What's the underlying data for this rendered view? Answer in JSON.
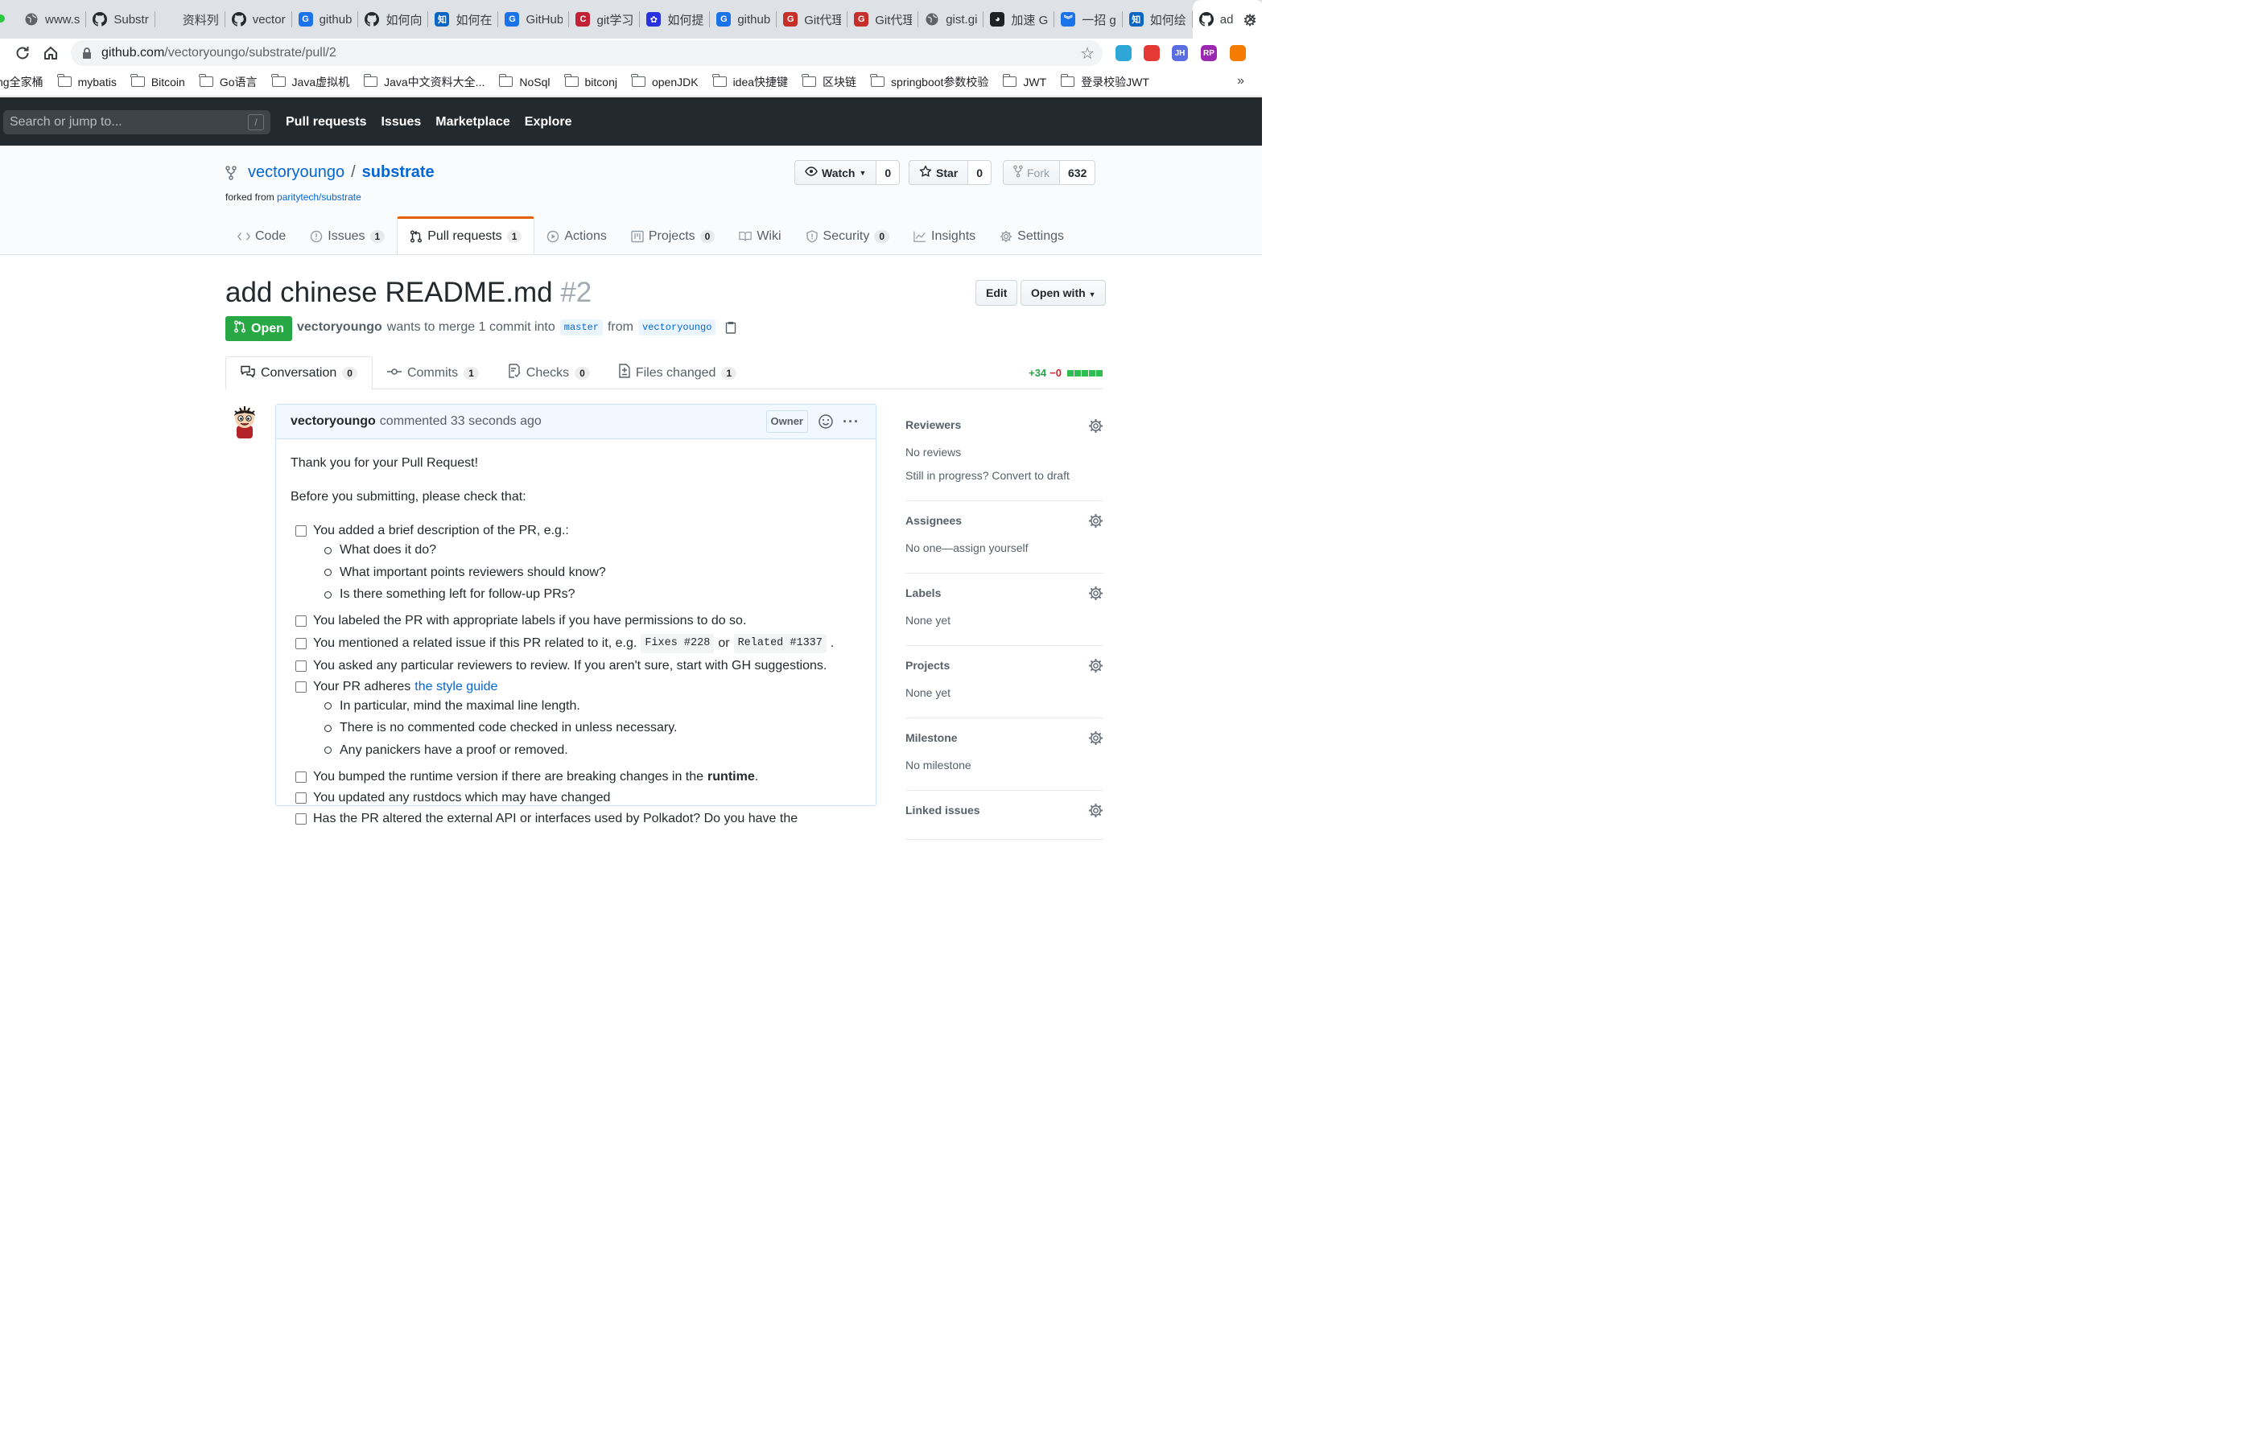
{
  "browser": {
    "tabs": [
      {
        "title": "www.s",
        "favicon": "globe-icon",
        "color": "#5f6368"
      },
      {
        "title": "Substr",
        "favicon": "github-icon",
        "color": "#24292e"
      },
      {
        "title": "资料列",
        "favicon": "blank-icon",
        "color": "#dee1e6"
      },
      {
        "title": "vector",
        "favicon": "github-icon",
        "color": "#24292e"
      },
      {
        "title": "github",
        "favicon": "letter-g-icon",
        "color": "#1a73e8"
      },
      {
        "title": "如何向",
        "favicon": "github-icon",
        "color": "#24292e"
      },
      {
        "title": "如何在",
        "favicon": "zhihu-icon",
        "color": "#0a66c2"
      },
      {
        "title": "GitHub",
        "favicon": "letter-g-icon",
        "color": "#1a73e8"
      },
      {
        "title": "git学习",
        "favicon": "csdn-icon",
        "color": "#c32136"
      },
      {
        "title": "如何提",
        "favicon": "baidu-icon",
        "color": "#2932e1"
      },
      {
        "title": "github",
        "favicon": "letter-g-icon",
        "color": "#1a73e8"
      },
      {
        "title": "Git代理",
        "favicon": "letter-g-red-icon",
        "color": "#c7302a"
      },
      {
        "title": "Git代理",
        "favicon": "letter-g-red-icon",
        "color": "#c7302a"
      },
      {
        "title": "gist.gi",
        "favicon": "globe-icon",
        "color": "#5f6368"
      },
      {
        "title": "加速 G",
        "favicon": "cat-icon",
        "color": "#202124"
      },
      {
        "title": "一招 g",
        "favicon": "chevrons-icon",
        "color": "#1a73e8"
      },
      {
        "title": "如何绘",
        "favicon": "zhihu-icon",
        "color": "#0a66c2"
      }
    ],
    "active_tab": {
      "title": "ad",
      "favicon": "github-icon"
    },
    "url_host": "github.com",
    "url_path": "/vectoryoungo/substrate/pull/2",
    "bookmarks": [
      "ng全家桶",
      "mybatis",
      "Bitcoin",
      "Go语言",
      "Java虚拟机",
      "Java中文资料大全...",
      "NoSql",
      "bitconj",
      "openJDK",
      "idea快捷键",
      "区块链",
      "springboot参数校验",
      "JWT",
      "登录校验JWT"
    ],
    "bookmarks_more": "»",
    "extensions": [
      {
        "name": "shield-ext-icon",
        "label": "",
        "color": "#2ea6d6"
      },
      {
        "name": "red-ext-icon",
        "label": "",
        "color": "#e53935"
      },
      {
        "name": "jh-ext-icon",
        "label": "JH",
        "color": "#5b6ee1"
      },
      {
        "name": "rp-ext-icon",
        "label": "RP",
        "color": "#9c27b0"
      },
      {
        "name": "orange-ext-icon",
        "label": "",
        "color": "#f57c00"
      }
    ]
  },
  "gh_header": {
    "search_placeholder": "Search or jump to...",
    "search_key": "/",
    "nav": [
      "Pull requests",
      "Issues",
      "Marketplace",
      "Explore"
    ]
  },
  "repo": {
    "owner": "vectoryoungo",
    "name": "substrate",
    "forked_label": "forked from",
    "forked_from": "paritytech/substrate",
    "watch_label": "Watch",
    "watch_count": "0",
    "star_label": "Star",
    "star_count": "0",
    "fork_label": "Fork",
    "fork_count": "632",
    "tabs": [
      {
        "label": "Code",
        "count": ""
      },
      {
        "label": "Issues",
        "count": "1"
      },
      {
        "label": "Pull requests",
        "count": "1"
      },
      {
        "label": "Actions",
        "count": ""
      },
      {
        "label": "Projects",
        "count": "0"
      },
      {
        "label": "Wiki",
        "count": ""
      },
      {
        "label": "Security",
        "count": "0"
      },
      {
        "label": "Insights",
        "count": ""
      },
      {
        "label": "Settings",
        "count": ""
      }
    ]
  },
  "pr": {
    "title": "add chinese README.md",
    "number": "#2",
    "edit_label": "Edit",
    "open_with_label": "Open with",
    "state": "Open",
    "author": "vectoryoungo",
    "meta_text": "wants to merge 1 commit into",
    "base_branch": "master",
    "from_text": "from",
    "head_branch": "vectoryoungo",
    "tabs": [
      {
        "label": "Conversation",
        "count": "0"
      },
      {
        "label": "Commits",
        "count": "1"
      },
      {
        "label": "Checks",
        "count": "0"
      },
      {
        "label": "Files changed",
        "count": "1"
      }
    ],
    "additions": "+34",
    "deletions": "−0"
  },
  "comment": {
    "author": "vectoryoungo",
    "time_text": "commented 33 seconds ago",
    "owner_badge": "Owner",
    "more": "···",
    "para1": "Thank you for your Pull Request!",
    "para2": "Before you submitting, please check that:",
    "item1": "You added a brief description of the PR, e.g.:",
    "item1_sub": [
      "What does it do?",
      "What important points reviewers should know?",
      "Is there something left for follow-up PRs?"
    ],
    "item2": "You labeled the PR with appropriate labels if you have permissions to do so.",
    "item3_pre": "You mentioned a related issue if this PR related to it, e.g.",
    "item3_code1": "Fixes #228",
    "item3_or": "or",
    "item3_code2": "Related #1337",
    "item3_post": ".",
    "item4": "You asked any particular reviewers to review. If you aren't sure, start with GH suggestions.",
    "item5_pre": "Your PR adheres",
    "item5_link": "the style guide",
    "item5_sub": [
      "In particular, mind the maximal line length.",
      "There is no commented code checked in unless necessary.",
      "Any panickers have a proof or removed."
    ],
    "item6_pre": "You bumped the runtime version if there are breaking changes in the",
    "item6_strong": "runtime",
    "item6_post": ".",
    "item7": "You updated any rustdocs which may have changed",
    "item8": "Has the PR altered the external API or interfaces used by Polkadot? Do you have the"
  },
  "sidebar": [
    {
      "title": "Reviewers",
      "lines": [
        "No reviews",
        "Still in progress? Convert to draft"
      ]
    },
    {
      "title": "Assignees",
      "lines": [
        "No one—assign yourself"
      ]
    },
    {
      "title": "Labels",
      "lines": [
        "None yet"
      ]
    },
    {
      "title": "Projects",
      "lines": [
        "None yet"
      ]
    },
    {
      "title": "Milestone",
      "lines": [
        "No milestone"
      ]
    },
    {
      "title": "Linked issues",
      "lines": []
    }
  ]
}
